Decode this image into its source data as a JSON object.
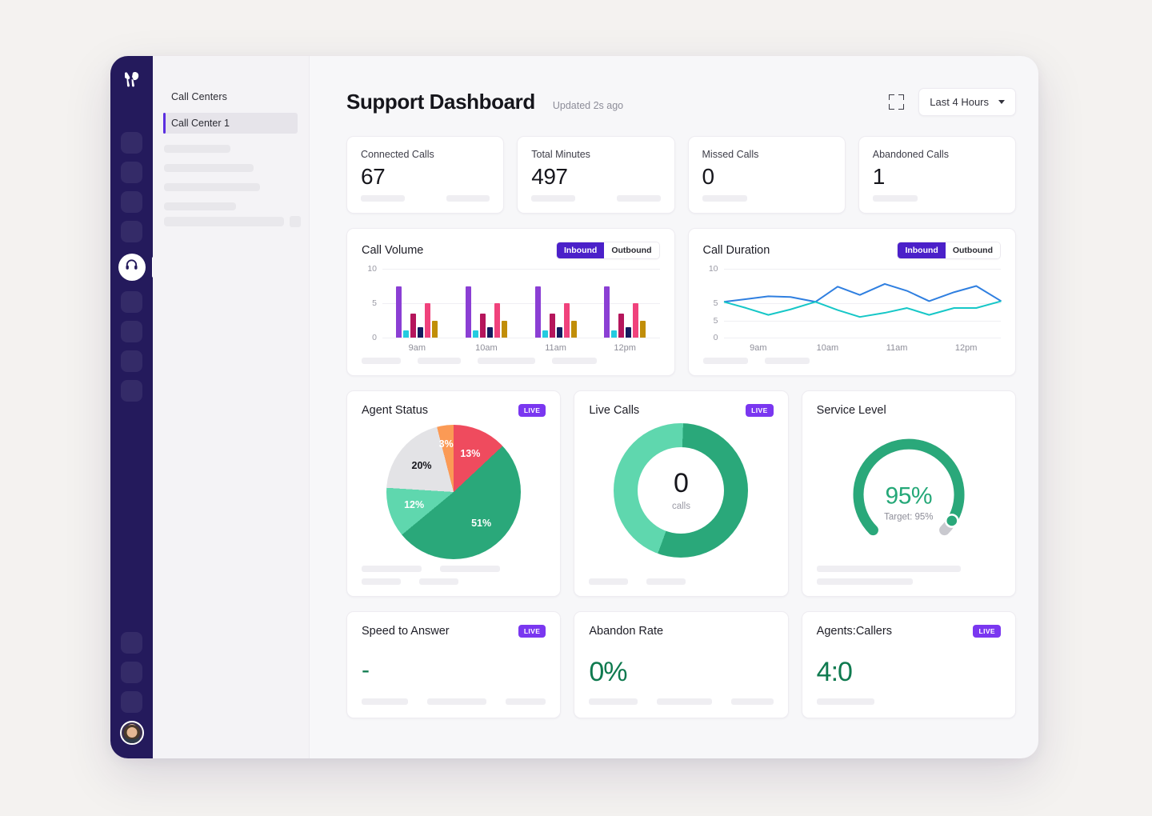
{
  "app": {
    "rail": {
      "logo_icon": "brand-logo-icon",
      "placeholder_count_top": 4,
      "active_item_icon": "headset-icon",
      "placeholder_count_mid": 4,
      "placeholder_count_bottom": 3,
      "avatar_icon": "user-avatar"
    },
    "panel": {
      "title": "Call Centers",
      "selected_item": "Call Center 1"
    },
    "header": {
      "title": "Support Dashboard",
      "updated": "Updated 2s ago",
      "expand_icon": "fullscreen-icon",
      "range_value": "Last 4 Hours",
      "caret_icon": "chevron-down-icon"
    }
  },
  "kpis": [
    {
      "label": "Connected Calls",
      "value": "67"
    },
    {
      "label": "Total Minutes",
      "value": "497"
    },
    {
      "label": "Missed Calls",
      "value": "0"
    },
    {
      "label": "Abandoned Calls",
      "value": "1"
    }
  ],
  "toggle": {
    "inbound": "Inbound",
    "outbound": "Outbound",
    "selected": "Inbound"
  },
  "badges": {
    "live": "LIVE"
  },
  "cards": {
    "call_volume": {
      "title": "Call Volume"
    },
    "call_duration": {
      "title": "Call Duration"
    },
    "agent_status": {
      "title": "Agent Status"
    },
    "live_calls": {
      "title": "Live Calls",
      "value": "0",
      "unit": "calls"
    },
    "service_level": {
      "title": "Service Level",
      "value": "95%",
      "target": "Target: 95%"
    },
    "speed_to_answer": {
      "title": "Speed to Answer",
      "value": "-"
    },
    "abandon_rate": {
      "title": "Abandon Rate",
      "value": "0%"
    },
    "agents_callers": {
      "title": "Agents:Callers",
      "value": "4:0"
    }
  },
  "chart_data": [
    {
      "type": "bar",
      "title": "Call Volume",
      "xlabel": "",
      "ylabel": "",
      "ylim": [
        0,
        10
      ],
      "yticks": [
        0,
        5,
        10
      ],
      "categories": [
        "9am",
        "10am",
        "11am",
        "12pm"
      ],
      "grid": true,
      "legend": [
        "Inbound",
        "Outbound"
      ],
      "series": [
        {
          "name": "s1",
          "color": "#8b3fd4",
          "values": [
            7.5,
            7.5,
            7.5,
            7.5
          ]
        },
        {
          "name": "s2",
          "color": "#23cbe0",
          "values": [
            1.0,
            1.0,
            1.0,
            1.0
          ]
        },
        {
          "name": "s3",
          "color": "#b5165c",
          "values": [
            3.5,
            3.5,
            3.5,
            3.5
          ]
        },
        {
          "name": "s4",
          "color": "#141b5e",
          "values": [
            1.5,
            1.5,
            1.5,
            1.5
          ]
        },
        {
          "name": "s5",
          "color": "#f0427c",
          "values": [
            5.0,
            5.0,
            5.0,
            5.0
          ]
        },
        {
          "name": "s6",
          "color": "#c18e08",
          "values": [
            2.5,
            2.5,
            2.5,
            2.5
          ]
        }
      ]
    },
    {
      "type": "line",
      "title": "Call Duration",
      "xlabel": "",
      "ylabel": "",
      "ylim": [
        0,
        10
      ],
      "yticks": [
        "0",
        "5",
        "5",
        "10"
      ],
      "categories": [
        "9am",
        "10am",
        "11am",
        "12pm"
      ],
      "grid": true,
      "legend": [
        "Inbound",
        "Outbound"
      ],
      "series": [
        {
          "name": "Inbound",
          "color": "#2f7fe0",
          "points": [
            [
              0,
              5.2
            ],
            [
              8,
              5.6
            ],
            [
              16,
              6.0
            ],
            [
              24,
              5.9
            ],
            [
              33,
              5.2
            ],
            [
              41,
              7.4
            ],
            [
              49,
              6.2
            ],
            [
              58,
              7.8
            ],
            [
              66,
              6.8
            ],
            [
              74,
              5.3
            ],
            [
              83,
              6.6
            ],
            [
              91,
              7.5
            ],
            [
              100,
              5.3
            ]
          ]
        },
        {
          "name": "Outbound",
          "color": "#16c7c7",
          "points": [
            [
              0,
              5.2
            ],
            [
              8,
              4.3
            ],
            [
              16,
              3.3
            ],
            [
              24,
              4.1
            ],
            [
              33,
              5.2
            ],
            [
              41,
              4.0
            ],
            [
              49,
              3.0
            ],
            [
              58,
              3.6
            ],
            [
              66,
              4.3
            ],
            [
              74,
              3.3
            ],
            [
              83,
              4.3
            ],
            [
              91,
              4.3
            ],
            [
              100,
              5.3
            ]
          ]
        }
      ]
    },
    {
      "type": "pie",
      "title": "Agent Status",
      "labels": [
        "13%",
        "51%",
        "12%",
        "20%",
        "3%"
      ],
      "values": [
        13,
        51,
        12,
        20,
        3
      ],
      "colors": [
        "#ef4b5e",
        "#2aa87a",
        "#5fd7ae",
        "#e3e3e6",
        "#fb9a55"
      ],
      "label_colors": [
        "#ffffff",
        "#ffffff",
        "#ffffff",
        "#16161c",
        "#ffffff"
      ]
    },
    {
      "type": "pie",
      "title": "Live Calls",
      "labels": [
        "",
        ""
      ],
      "values": [
        45,
        55
      ],
      "colors": [
        "#5fd7ae",
        "#2aa87a"
      ],
      "center_value": "0",
      "center_unit": "calls"
    },
    {
      "type": "pie",
      "title": "Service Level",
      "values": [
        95,
        5
      ],
      "colors": [
        "#2aa87a",
        "#c9c9cf"
      ],
      "center_value": "95%",
      "center_sub": "Target: 95%"
    }
  ]
}
